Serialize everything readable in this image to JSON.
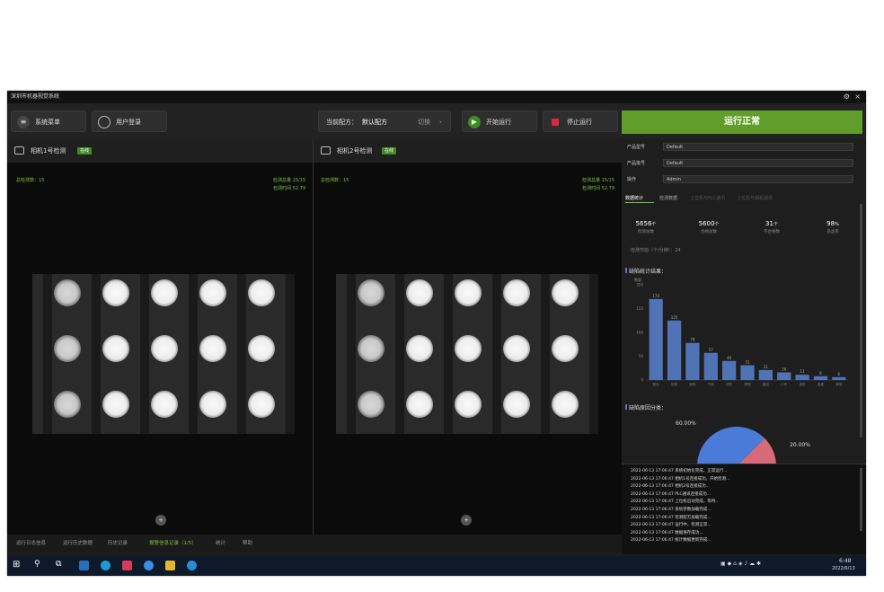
{
  "window": {
    "title": "深圳市机器视觉系统"
  },
  "toolbar": {
    "menu_label": "系统菜单",
    "user_label": "用户登录",
    "recipe_prefix": "当前配方：",
    "recipe_value": "默认配方",
    "recipe_switch": "切换",
    "start_label": "开始运行",
    "stop_label": "停止运行",
    "status_label": "运行正常"
  },
  "cam1": {
    "name": "相机1号检测",
    "tag": "在线",
    "left_stat": "总检测数：15",
    "right_stat_1": "检测总量 15/15",
    "right_stat_2": "检测时间 52.79"
  },
  "cam2": {
    "name": "相机2号检测",
    "tag": "在线",
    "left_stat": "总检测数：15",
    "right_stat_1": "检测总量 15/15",
    "right_stat_2": "检测时间 52.79"
  },
  "bottom_tabs": [
    "运行日志信息",
    "运行历史数据",
    "历史记录",
    "报警信息记录（1/5）",
    "统计",
    "帮助"
  ],
  "right": {
    "fields": [
      {
        "label": "产品型号",
        "value": "Default"
      },
      {
        "label": "产品批号",
        "value": "Default"
      },
      {
        "label": "操作",
        "value": "Admin"
      }
    ],
    "tabs": [
      "数据统计",
      "检测数据",
      "上位机与PLC通讯",
      "上位机与相机通讯"
    ],
    "stats": [
      {
        "value": "5656",
        "unit": "个",
        "key": "检测总数"
      },
      {
        "value": "5600",
        "unit": "个",
        "key": "合格总数"
      },
      {
        "value": "31",
        "unit": "个",
        "key": "不合格数"
      },
      {
        "value": "98",
        "unit": "%",
        "key": "良品率"
      }
    ],
    "extra": "检测节拍（个/分钟）：24",
    "bar_title": "缺陷统计结果：",
    "pie_title": "缺陷原因分类：",
    "pie_labels": [
      "60.00%",
      "20.00%"
    ]
  },
  "chart_data": [
    {
      "type": "bar",
      "title": "缺陷统计结果：",
      "ylabel": "数量",
      "ylim": [
        0,
        200
      ],
      "yticks": [
        0,
        50,
        100,
        150,
        200
      ],
      "categories": [
        "脏污",
        "划伤",
        "缺料",
        "气泡",
        "压伤",
        "异物",
        "崩边",
        "少件",
        "变形",
        "色差",
        "其他"
      ],
      "values": [
        170,
        125,
        78,
        57,
        40,
        31,
        21,
        16,
        11,
        8,
        6
      ],
      "color": "#4f73b5"
    },
    {
      "type": "pie",
      "title": "缺陷原因分类：",
      "slices": [
        {
          "label": "60.00%",
          "value": 60,
          "color": "#4a7bd8"
        },
        {
          "label": "20.00%",
          "value": 20,
          "color": "#d8697a"
        }
      ]
    }
  ],
  "log": {
    "lines": [
      "2022-06-13 17:06:47 系统初始化完成，正常运行...",
      "2022-06-13 17:06:47 相机1号连接成功，开始检测...",
      "2022-06-13 17:06:47 相机2号连接成功...",
      "2022-06-13 17:06:47 PLC通讯连接成功...",
      "2022-06-13 17:06:47 上位机启动完成，等待...",
      "2022-06-13 17:06:47 系统参数加载完成...",
      "2022-06-13 17:06:47 检测配方加载完成...",
      "2022-06-13 17:06:47 运行中，检测正常...",
      "2022-06-13 17:06:47 数据保存成功...",
      "2022-06-13 17:06:47 统计数据更新完成..."
    ]
  },
  "taskbar": {
    "time": "6:48",
    "date": "2022/6/13"
  }
}
